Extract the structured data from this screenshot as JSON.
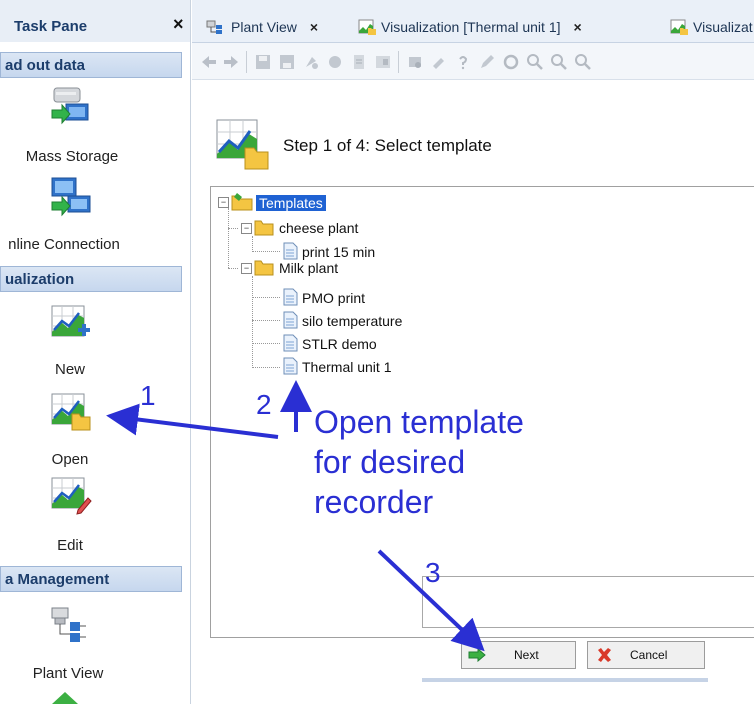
{
  "task_pane": {
    "title": "Task Pane",
    "close": "×",
    "sections": [
      {
        "label": "ad out data"
      },
      {
        "label": "ualization"
      },
      {
        "label": "a Management"
      }
    ],
    "items": [
      {
        "label": "Mass Storage",
        "icon": "mass-storage-icon"
      },
      {
        "label": "nline Connection",
        "icon": "online-connection-icon"
      },
      {
        "label": "New",
        "icon": "new-visualization-icon"
      },
      {
        "label": "Open",
        "icon": "open-visualization-icon"
      },
      {
        "label": "Edit",
        "icon": "edit-visualization-icon"
      },
      {
        "label": "Plant View",
        "icon": "plant-view-icon"
      }
    ]
  },
  "tabs": [
    {
      "label": "Plant View",
      "close": "×"
    },
    {
      "label": "Visualization [Thermal unit 1]",
      "close": "×"
    },
    {
      "label": "Visualizat"
    }
  ],
  "wizard": {
    "step_title": "Step 1 of 4: Select template",
    "tree": {
      "root": "Templates",
      "groups": [
        {
          "label": "cheese plant",
          "items": [
            "print 15 min"
          ]
        },
        {
          "label": "Milk plant",
          "items": [
            "PMO print",
            "silo temperature",
            "STLR demo",
            "Thermal unit 1"
          ]
        }
      ]
    },
    "buttons": {
      "next": "Next",
      "cancel": "Cancel"
    }
  },
  "annotations": {
    "num1": "1",
    "num2": "2",
    "num3": "3",
    "text_line1": "Open template",
    "text_line2": "for desired",
    "text_line3": "recorder"
  },
  "colors": {
    "annotation": "#2a2fd3",
    "selection": "#1f62d3",
    "section_header": "#c6d7ee"
  }
}
